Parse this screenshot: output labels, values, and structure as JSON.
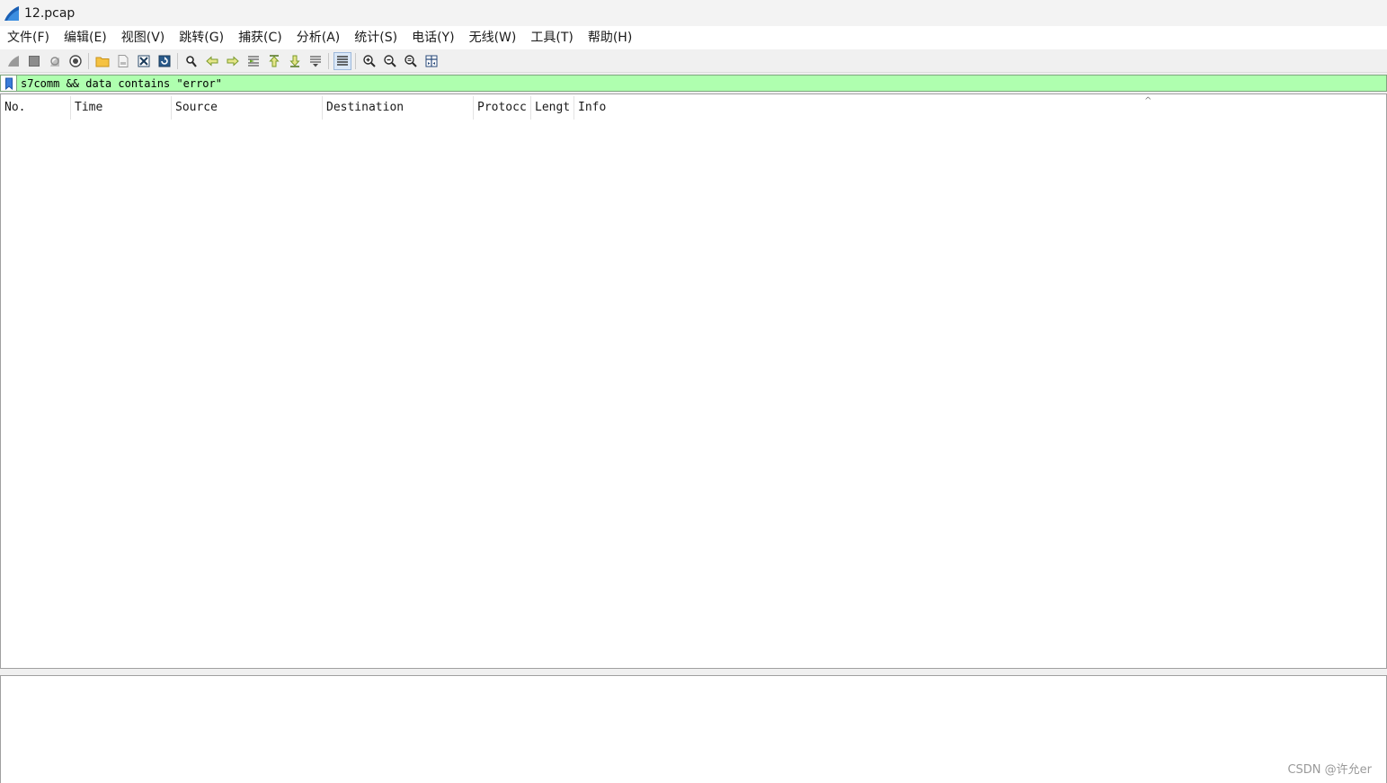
{
  "window": {
    "title": "12.pcap"
  },
  "menu": {
    "items": [
      "文件(F)",
      "编辑(E)",
      "视图(V)",
      "跳转(G)",
      "捕获(C)",
      "分析(A)",
      "统计(S)",
      "电话(Y)",
      "无线(W)",
      "工具(T)",
      "帮助(H)"
    ]
  },
  "toolbar": {
    "icons": [
      "start-capture-icon",
      "stop-capture-icon",
      "restart-capture-icon",
      "capture-options-icon",
      "open-file-icon",
      "save-file-icon",
      "close-file-icon",
      "reload-file-icon",
      "find-packet-icon",
      "go-back-icon",
      "go-forward-icon",
      "go-to-packet-icon",
      "first-packet-icon",
      "last-packet-icon",
      "auto-scroll-icon",
      "colorize-icon",
      "zoom-in-icon",
      "zoom-out-icon",
      "zoom-normal-icon",
      "resize-columns-icon"
    ]
  },
  "filter": {
    "value": "s7comm && data contains \"error\"",
    "valid_color": "#afffaf"
  },
  "packet_list": {
    "columns": [
      "No.",
      "Time",
      "Source",
      "Destination",
      "Protocc",
      "Lengt",
      "Info"
    ],
    "sort_indicator": "^",
    "rows": []
  },
  "watermark": "CSDN @许允er"
}
